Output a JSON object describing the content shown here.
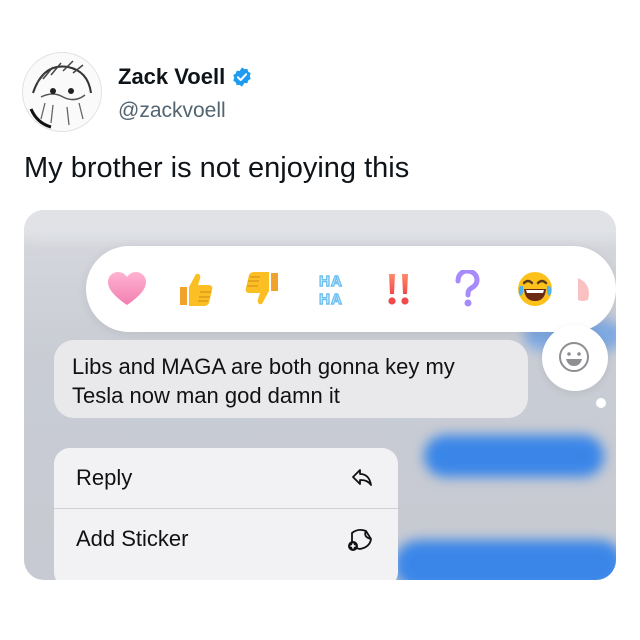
{
  "tweet": {
    "author_name": "Zack Voell",
    "handle": "@zackvoell",
    "text": "My brother is not enjoying this"
  },
  "screenshot": {
    "reactions": [
      {
        "name": "heart-icon"
      },
      {
        "name": "thumbs-up-icon"
      },
      {
        "name": "thumbs-down-icon"
      },
      {
        "name": "haha-icon",
        "label": "HA HA"
      },
      {
        "name": "exclamation-icon",
        "label": "!!"
      },
      {
        "name": "question-icon",
        "label": "?"
      },
      {
        "name": "laughing-emoji-icon"
      }
    ],
    "message_line1": "Libs and MAGA are both gonna key my",
    "message_line2": "Tesla now man god damn it",
    "menu": {
      "reply_label": "Reply",
      "add_sticker_label": "Add Sticker"
    }
  },
  "colors": {
    "verified_blue": "#1d9bf0",
    "message_bubble": "#e9e9eb",
    "blurred_blue": "#3a86e8"
  }
}
